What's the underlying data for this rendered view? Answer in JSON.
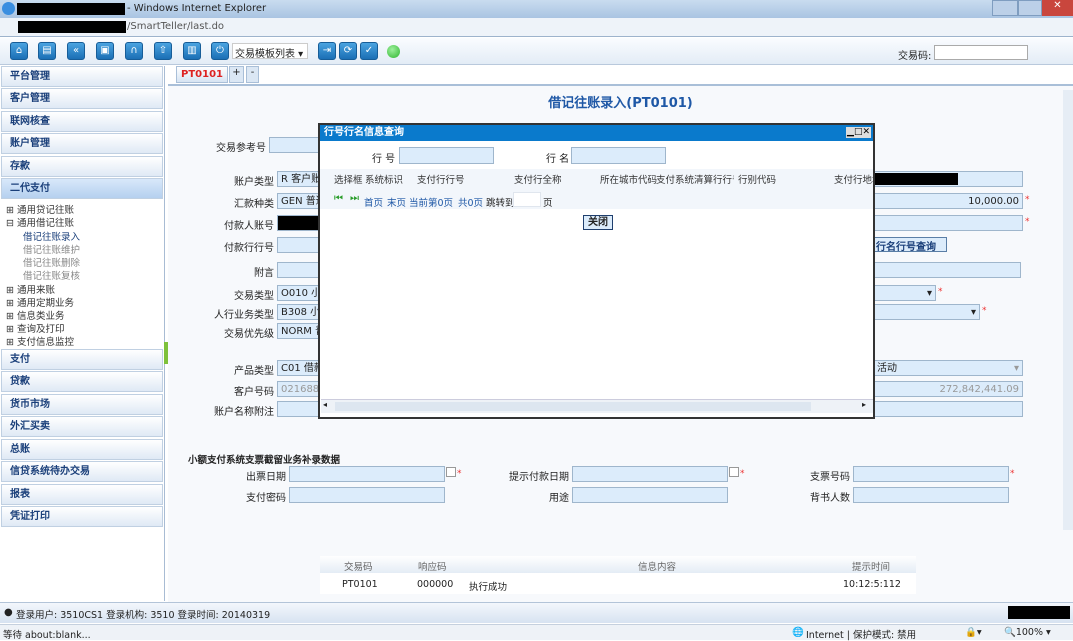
{
  "window": {
    "title": "- Windows Internet Explorer",
    "address": "/SmartTeller/last.do"
  },
  "toolbar": {
    "template_select": "交易模板列表",
    "trade_code_label": "交易码:",
    "trade_code_value": "",
    "icons": [
      "home-icon",
      "window-icon",
      "back-icon",
      "document-icon",
      "headset-icon",
      "upload-icon",
      "trash-icon",
      "power-icon",
      "login-icon",
      "refresh-icon",
      "check-icon"
    ],
    "status_color": "#2fb52f"
  },
  "sidebar": {
    "items": [
      "平台管理",
      "客户管理",
      "联网核查",
      "账户管理",
      "存款",
      "二代支付"
    ],
    "tree": [
      "通用贷记往账",
      "通用借记往账"
    ],
    "subitems": [
      "借记往账录入",
      "借记往账维护",
      "借记往账删除",
      "借记往账复核"
    ],
    "tree2": [
      "通用来账",
      "通用定期业务",
      "信息类业务",
      "查询及打印",
      "支付信息监控"
    ],
    "items2": [
      "支付",
      "贷款",
      "货币市场",
      "外汇买卖",
      "总账",
      "信贷系统待办交易",
      "报表",
      "凭证打印"
    ]
  },
  "tabs": {
    "active": "PT0101",
    "add": "+",
    "remove": "-"
  },
  "page": {
    "title": "借记往账录入(PT0101)"
  },
  "form": {
    "ref_label": "交易参考号",
    "acct_type_label": "账户类型",
    "acct_type": "R 客户账",
    "remit_label": "汇款种类",
    "remit": "GEN 普通",
    "amount": "10,000.00",
    "payer_label": "付款人账号",
    "bank_no_label": "付款行行号",
    "query_btn": "行名行号查询",
    "memo_label": "附言",
    "tx_type_label": "交易类型",
    "tx_type": "O010 小",
    "pboc_label": "人行业务类型",
    "pboc": "B308 小",
    "priority_label": "交易优先级",
    "priority": "NORM 普",
    "product_label": "产品类型",
    "product": "C01 借款",
    "product_right": "活动",
    "cust_label": "客户号码",
    "cust": "021688",
    "balance": "272,842,441.09",
    "acct_note_label": "账户名称附注"
  },
  "section": {
    "title": "小额支付系统支票截留业务补录数据",
    "issue_date": "出票日期",
    "present_date": "提示付款日期",
    "cheque_no": "支票号码",
    "pay_pwd": "支付密码",
    "purpose": "用途",
    "endorsers": "背书人数"
  },
  "dialog": {
    "title": "行号行名信息查询",
    "bank_no_label": "行 号",
    "bank_name_label": "行 名",
    "columns": [
      "选择框",
      "系统标识",
      "支付行行号",
      "支付行全称",
      "所在城市代码",
      "支付系统清算行行号",
      "行别代码",
      "支付行地址"
    ],
    "pager": {
      "first": "首页",
      "last": "末页",
      "current": "当前第0页",
      "total": "共0页",
      "jump": "跳转到",
      "page": "页"
    },
    "close": "关闭"
  },
  "result": {
    "columns": [
      "交易码",
      "响应码",
      "信息内容",
      "提示时间"
    ],
    "rows": [
      [
        "PT0101",
        "000000",
        "执行成功",
        "10:12:5:112"
      ]
    ]
  },
  "statusbar": {
    "text": "登录用户: 3510CS1 登录机构: 3510 登录时间: 20140319"
  },
  "ie": {
    "left": "等待 about:blank...",
    "zone": "Internet | 保护模式: 禁用",
    "zoom": "100%"
  }
}
